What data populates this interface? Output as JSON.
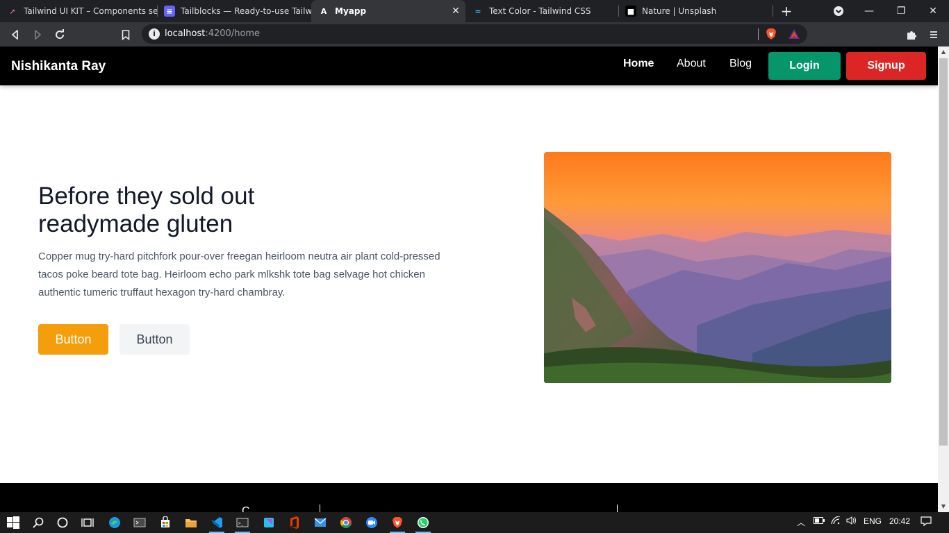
{
  "browser": {
    "tabs": [
      {
        "title": "Tailwind UI KIT – Components secti",
        "icon": "rocket-icon",
        "active": false
      },
      {
        "title": "Tailblocks — Ready-to-use Tailwind",
        "icon": "tailblocks-icon",
        "active": false
      },
      {
        "title": "Myapp",
        "icon": "angular-icon",
        "active": true
      },
      {
        "title": "Text Color - Tailwind CSS",
        "icon": "tailwind-icon",
        "active": false
      },
      {
        "title": "Nature | Unsplash",
        "icon": "unsplash-icon",
        "active": false
      }
    ],
    "address": {
      "host": "localhost",
      "rest": ":4200/home"
    }
  },
  "navbar": {
    "brand": "Nishikanta Ray",
    "links": [
      "Home",
      "About",
      "Blog"
    ],
    "login_label": "Login",
    "signup_label": "Signup"
  },
  "hero": {
    "title_line1": "Before they sold out",
    "title_line2": "readymade gluten",
    "text_line1": "Copper mug try-hard pitchfork pour-over freegan heirloom neutra air plant cold-pressed",
    "text_line2": "tacos poke beard tote bag. Heirloom echo park mlkshk tote bag selvage hot chicken",
    "text_line3": "authentic tumeric truffaut hexagon try-hard chambray.",
    "primary_button": "Button",
    "secondary_button": "Button",
    "image": "mountain-sunset-landscape"
  },
  "footer": {
    "partial_text": "C"
  },
  "taskbar": {
    "language": "ENG",
    "time": "20:42"
  },
  "colors": {
    "login": "#059669",
    "signup": "#dc2626",
    "primary_button": "#f59e0b"
  }
}
